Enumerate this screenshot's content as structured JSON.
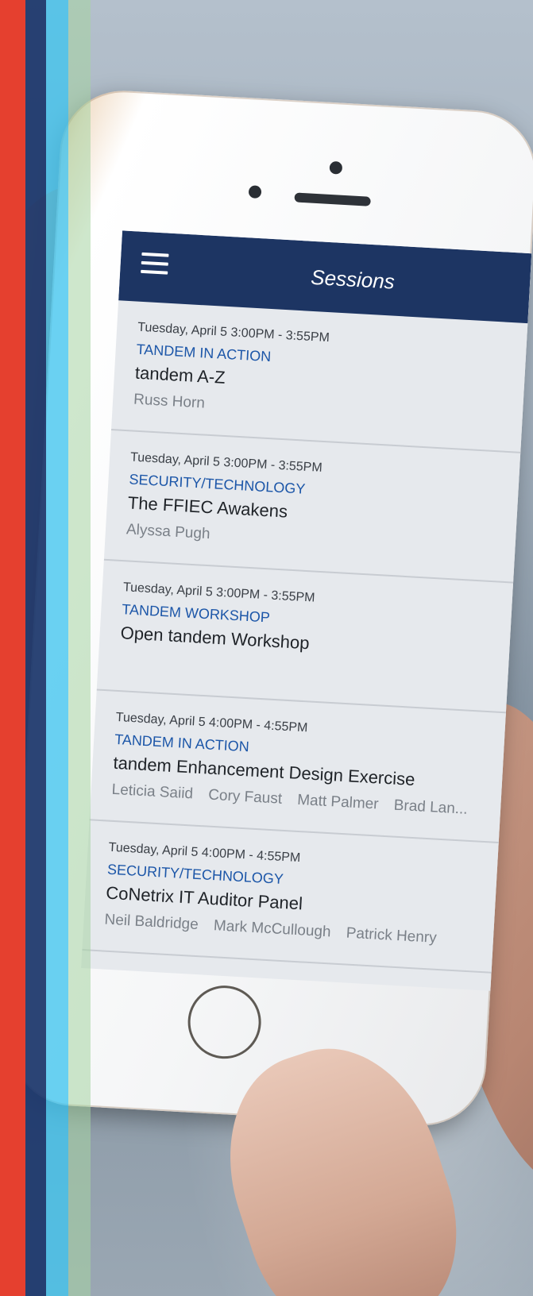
{
  "colors": {
    "app_bar": "#1d3563",
    "track_text": "#1c56a8",
    "stripe_red": "#e5402f",
    "stripe_navy": "#1e386c",
    "stripe_cyan": "#40c4ee",
    "stripe_green": "#a5d4a2"
  },
  "app_bar": {
    "title": "Sessions",
    "menu_icon": "hamburger-menu-icon"
  },
  "sessions": [
    {
      "time": "Tuesday, April 5 3:00PM - 3:55PM",
      "track": "TANDEM IN ACTION",
      "title": "tandem A-Z",
      "speakers": [
        "Russ Horn"
      ]
    },
    {
      "time": "Tuesday, April 5 3:00PM - 3:55PM",
      "track": "SECURITY/TECHNOLOGY",
      "title": "The FFIEC Awakens",
      "speakers": [
        "Alyssa Pugh"
      ]
    },
    {
      "time": "Tuesday, April 5 3:00PM - 3:55PM",
      "track": "TANDEM WORKSHOP",
      "title": "Open tandem Workshop",
      "speakers": []
    },
    {
      "time": "Tuesday, April 5 4:00PM - 4:55PM",
      "track": "TANDEM IN ACTION",
      "title": "tandem Enhancement Design Exercise",
      "speakers": [
        "Leticia Saiid",
        "Cory Faust",
        "Matt Palmer",
        "Brad Lan..."
      ]
    },
    {
      "time": "Tuesday, April 5 4:00PM - 4:55PM",
      "track": "SECURITY/TECHNOLOGY",
      "title": "CoNetrix IT Auditor Panel",
      "speakers": [
        "Neil Baldridge",
        "Mark McCullough",
        "Patrick Henry"
      ]
    }
  ]
}
